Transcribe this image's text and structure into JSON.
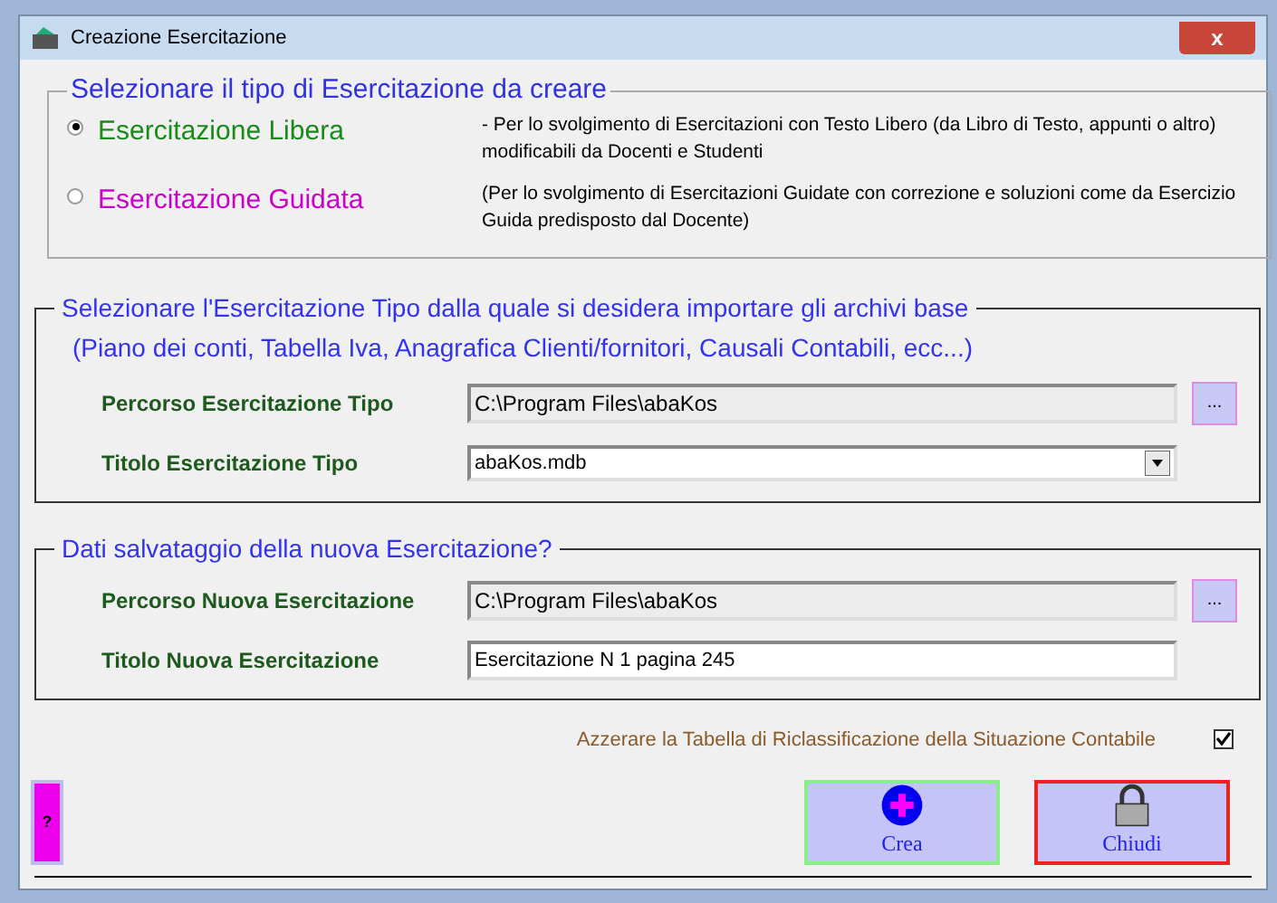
{
  "window": {
    "title": "Creazione Esercitazione",
    "close_label": "x"
  },
  "type_group": {
    "legend": "Selezionare il tipo di Esercitazione da creare",
    "options": [
      {
        "label": "Esercitazione Libera",
        "color": "#1a8a1a",
        "selected": true,
        "description": "- Per lo svolgimento di Esercitazioni con Testo Libero (da Libro di Testo, appunti o altro) modificabili da Docenti e Studenti"
      },
      {
        "label": "Esercitazione Guidata",
        "color": "#cc00cc",
        "selected": false,
        "description": "(Per lo svolgimento di Esercitazioni Guidate con correzione e soluzioni come da Esercizio Guida predisposto dal Docente)"
      }
    ]
  },
  "import_group": {
    "legend": "Selezionare l'Esercitazione Tipo dalla quale si desidera importare gli archivi base",
    "legend_2": "(Piano dei conti, Tabella Iva, Anagrafica Clienti/fornitori, Causali Contabili, ecc...)",
    "rows": [
      {
        "kind": "path",
        "label": "Percorso Esercitazione Tipo",
        "value": "C:\\Program Files\\abaKos",
        "button": "..."
      },
      {
        "kind": "dropdown",
        "label": "Titolo Esercitazione Tipo",
        "value": "abaKos.mdb"
      }
    ]
  },
  "save_group": {
    "legend": "Dati  salvataggio della nuova Esercitazione?",
    "rows": [
      {
        "kind": "path",
        "label": "Percorso Nuova Esercitazione",
        "value": "C:\\Program Files\\abaKos",
        "button": "..."
      },
      {
        "kind": "text",
        "label": "Titolo Nuova Esercitazione",
        "value": "Esercitazione N 1 pagina 245"
      }
    ]
  },
  "reset_option": {
    "label": "Azzerare la Tabella di Riclassificazione della Situazione Contabile",
    "checked": true
  },
  "help_button": "?",
  "buttons": [
    {
      "kind": "create",
      "label": "Crea"
    },
    {
      "kind": "close",
      "label": "Chiudi"
    }
  ]
}
